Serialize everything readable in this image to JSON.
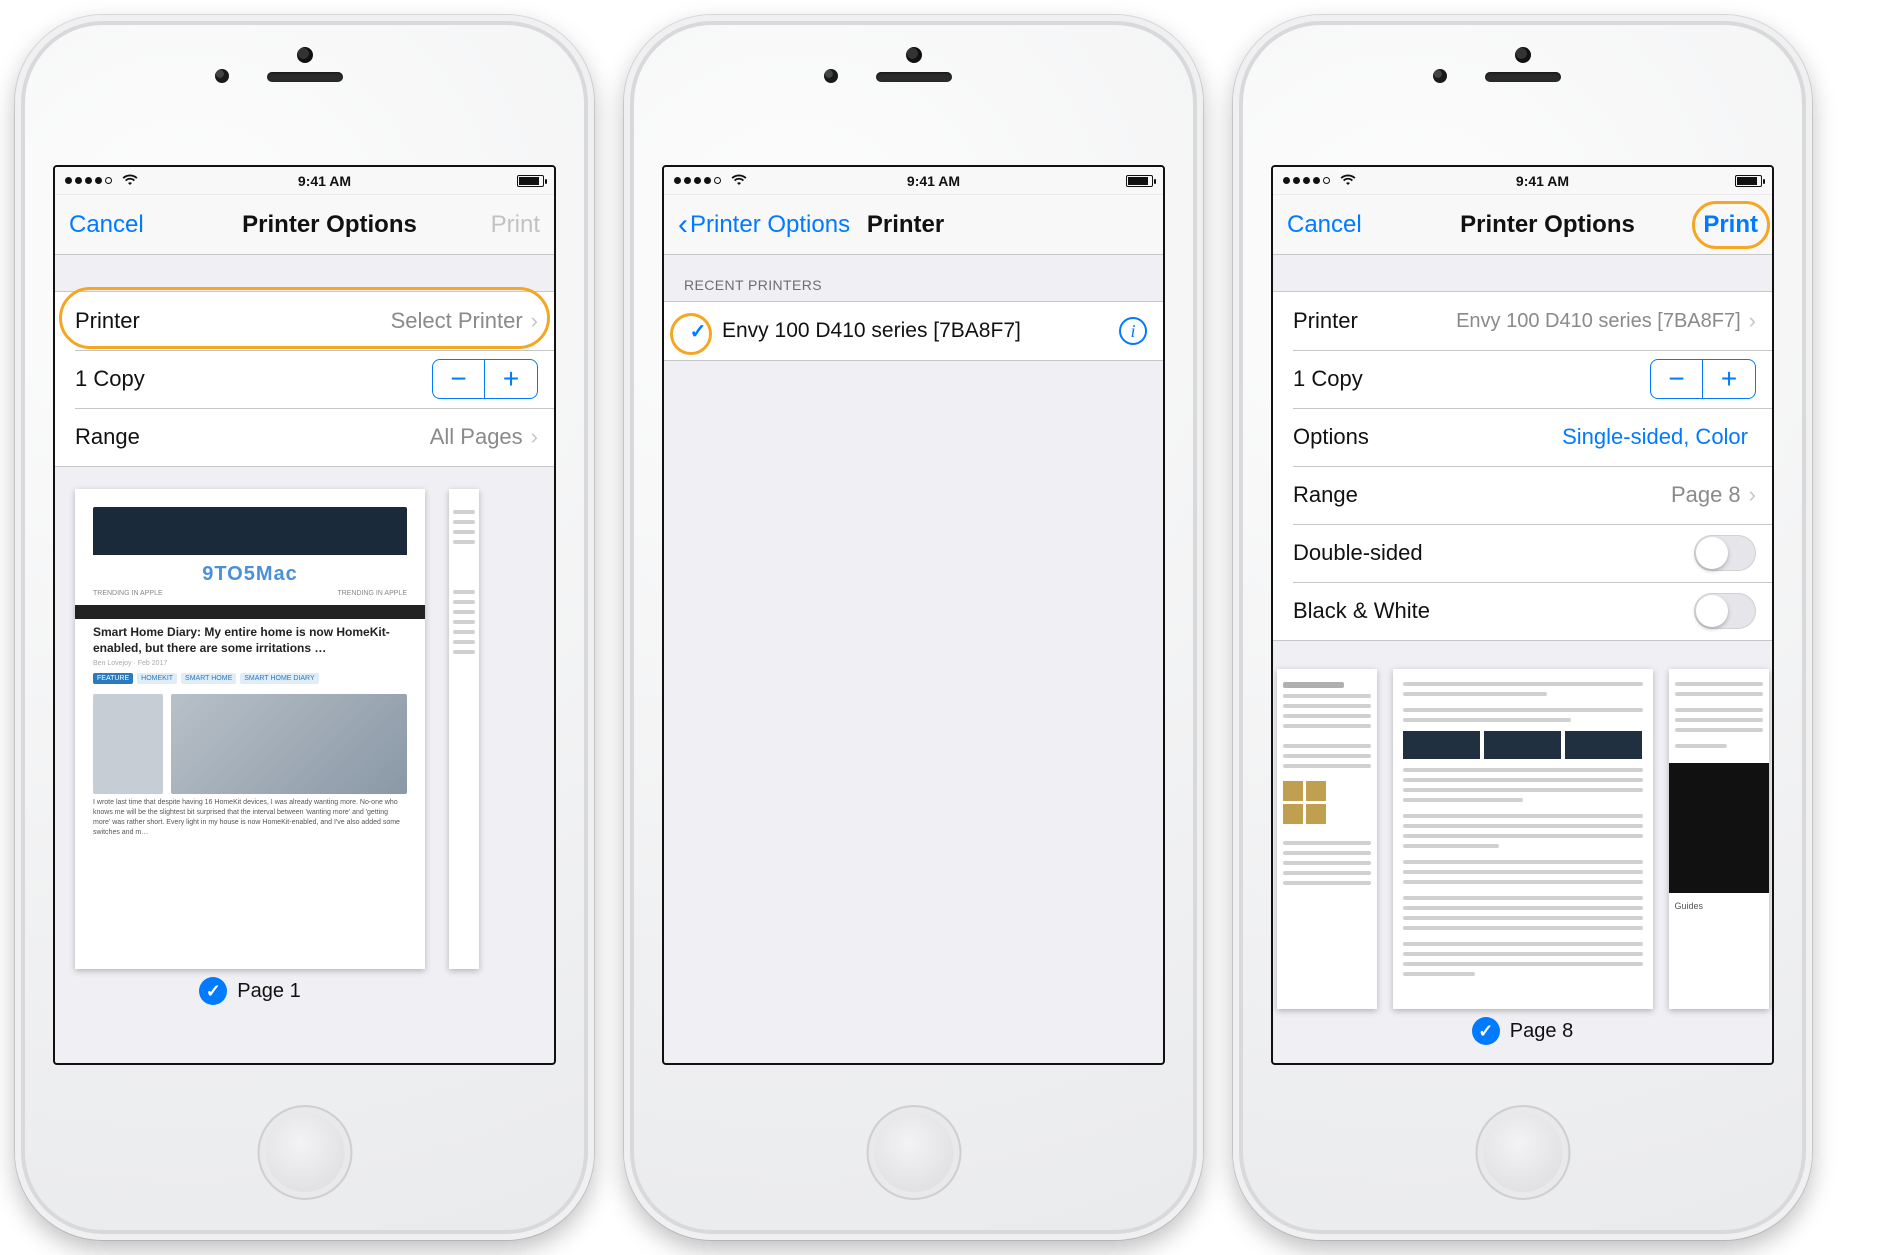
{
  "status_time": "9:41 AM",
  "screen1": {
    "nav_left": "Cancel",
    "nav_title": "Printer Options",
    "nav_right": "Print",
    "row_printer_label": "Printer",
    "row_printer_value": "Select Printer",
    "row_copies_label": "1 Copy",
    "row_range_label": "Range",
    "row_range_value": "All Pages",
    "page_label": "Page 1",
    "article_site": "9TO5Mac",
    "article_headline": "Smart Home Diary: My entire home is now HomeKit-enabled, but there are some irritations …",
    "tags": [
      "FEATURE",
      "HOMEKIT",
      "SMART HOME",
      "SMART HOME DIARY"
    ]
  },
  "screen2": {
    "nav_back": "Printer Options",
    "nav_title": "Printer",
    "group_header": "RECENT PRINTERS",
    "printer_name": "Envy 100 D410 series [7BA8F7]"
  },
  "screen3": {
    "nav_left": "Cancel",
    "nav_title": "Printer Options",
    "nav_right": "Print",
    "row_printer_label": "Printer",
    "row_printer_value": "Envy 100 D410 series [7BA8F7]",
    "row_copies_label": "1 Copy",
    "row_options_label": "Options",
    "row_options_value": "Single-sided, Color",
    "row_range_label": "Range",
    "row_range_value": "Page 8",
    "row_doublesided": "Double-sided",
    "row_bw": "Black & White",
    "page_label": "Page 8",
    "guides_label": "Guides"
  }
}
